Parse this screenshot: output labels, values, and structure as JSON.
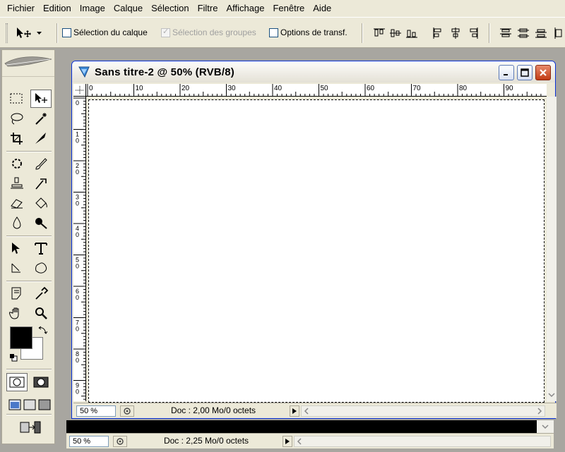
{
  "menu": [
    "Fichier",
    "Edition",
    "Image",
    "Calque",
    "Sélection",
    "Filtre",
    "Affichage",
    "Fenêtre",
    "Aide"
  ],
  "options_bar": {
    "auto_select_layer": "Sélection du calque",
    "auto_select_groups": "Sélection des groupes",
    "transform_options": "Options de transf."
  },
  "document": {
    "title": "Sans titre-2 @ 50% (RVB/8)",
    "zoom": "50 %",
    "doc_info": "Doc : 2,00 Mo/0 octets"
  },
  "background_document": {
    "zoom": "50 %",
    "doc_info": "Doc : 2,25 Mo/0 octets"
  },
  "rulers": {
    "horizontal": [
      "0",
      "10",
      "20",
      "30",
      "40",
      "50",
      "60",
      "70",
      "80",
      "90"
    ],
    "vertical": [
      "0",
      "1 0",
      "2 0",
      "3 0",
      "4 0",
      "5 0",
      "6 0",
      "7 0",
      "8 0",
      "9 0"
    ]
  },
  "colors": {
    "foreground": "#000000",
    "background": "#ffffff",
    "close_button": "#c23b14",
    "titlebar_border": "#0831d9"
  }
}
